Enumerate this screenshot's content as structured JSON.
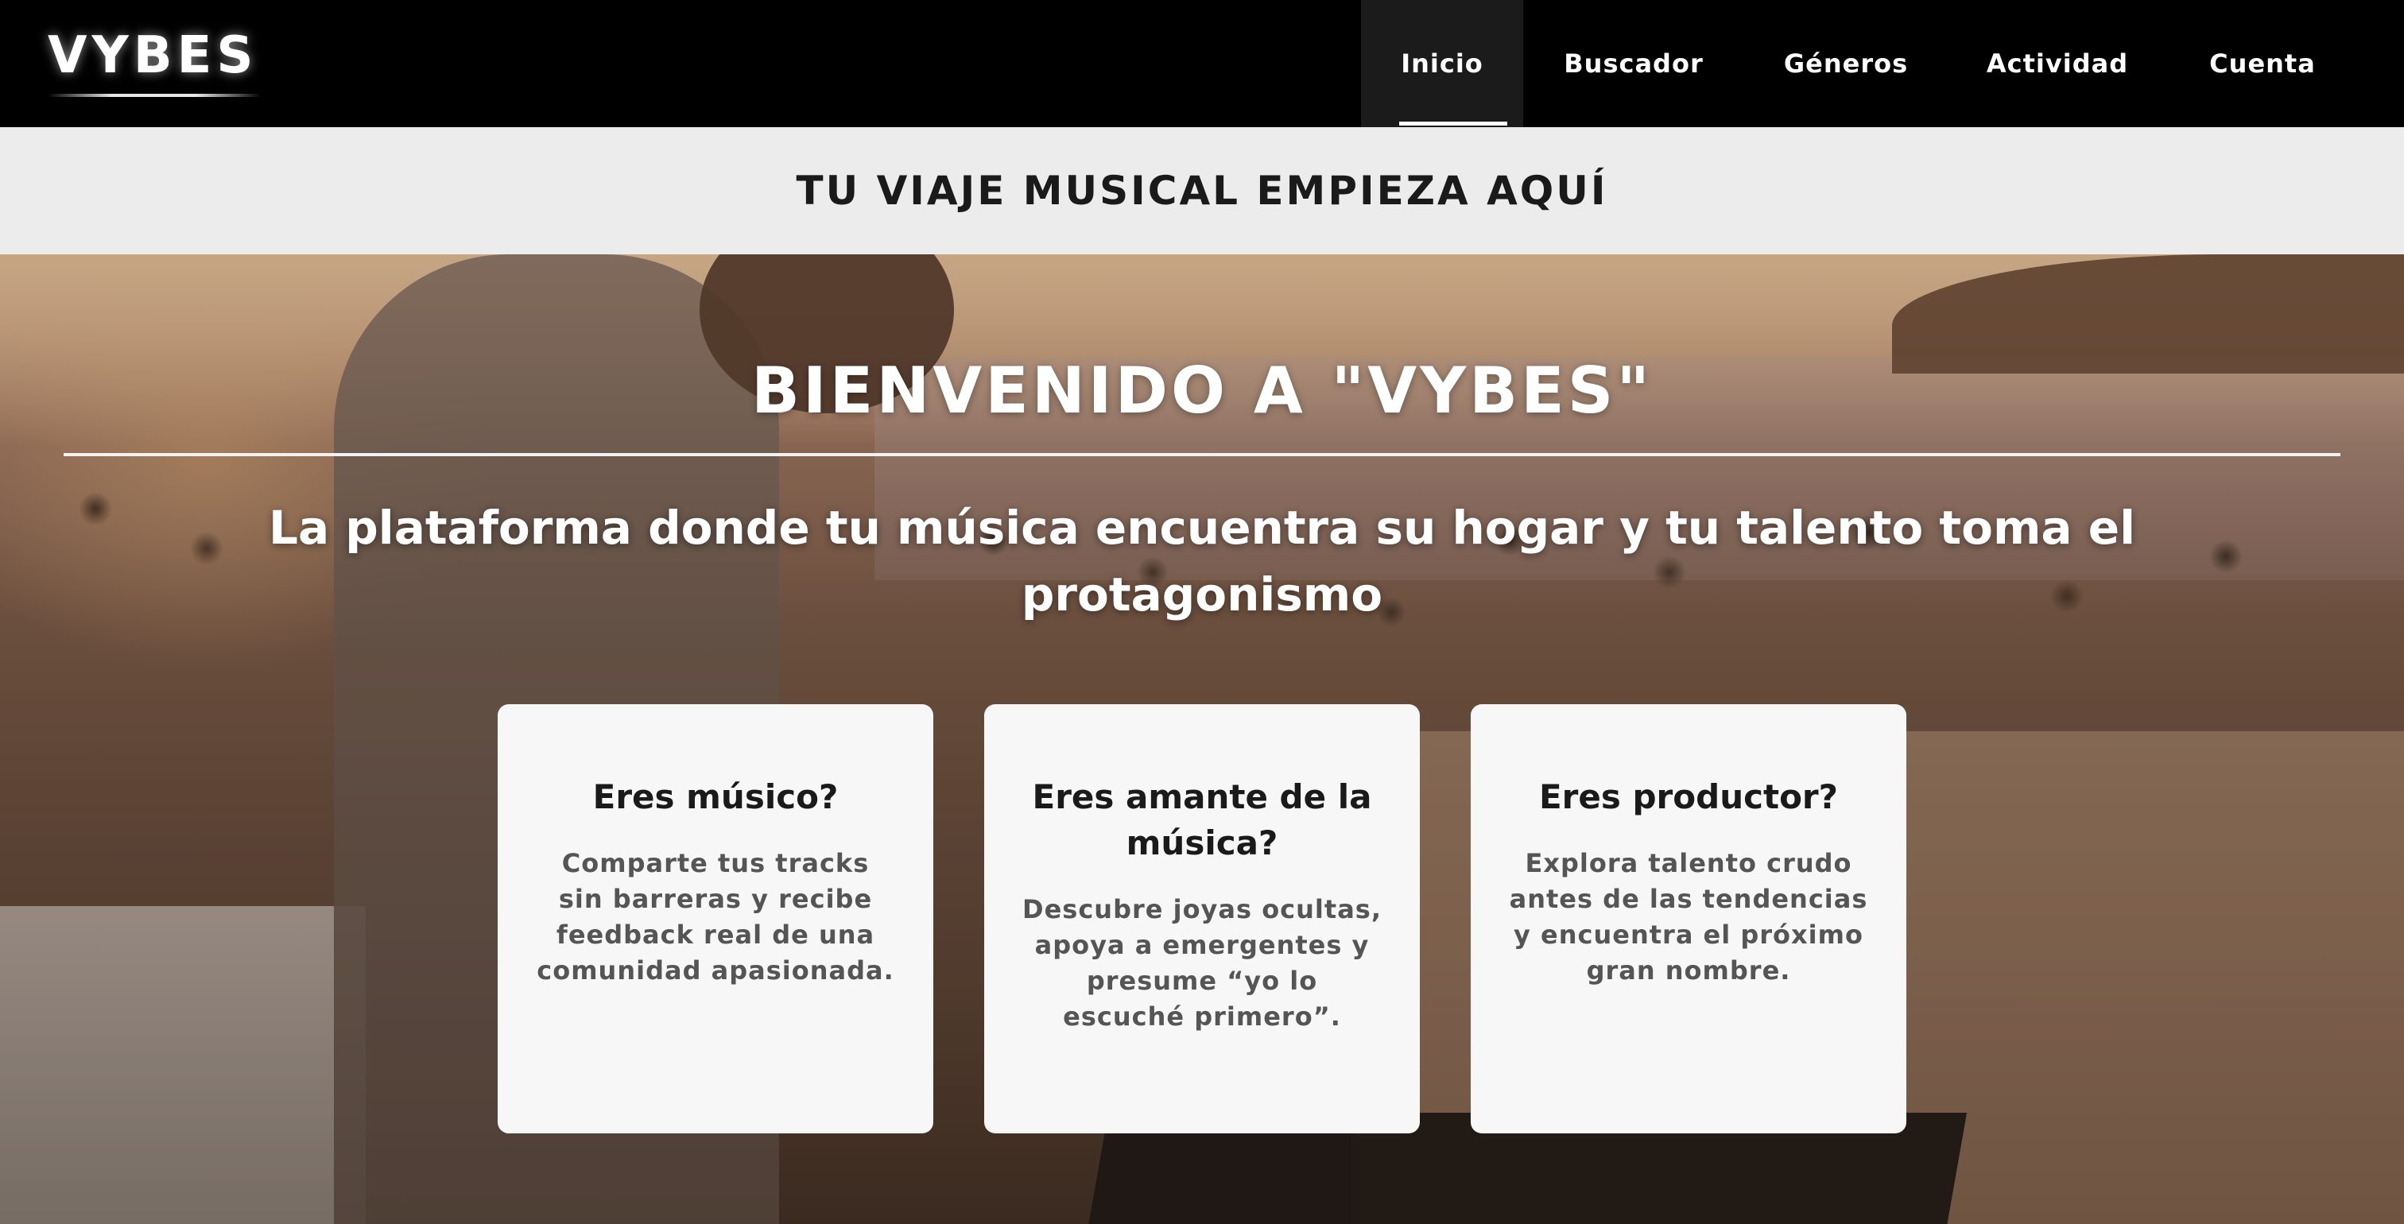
{
  "brand": {
    "logo_text": "VYBES"
  },
  "nav": {
    "items": [
      {
        "label": "Inicio",
        "active": true
      },
      {
        "label": "Buscador"
      },
      {
        "label": "Géneros"
      },
      {
        "label": "Actividad"
      },
      {
        "label": "Cuenta"
      }
    ]
  },
  "banner": {
    "text": "TU VIAJE MUSICAL EMPIEZA AQUÍ"
  },
  "hero": {
    "title": "BIENVENIDO A \"VYBES\"",
    "subtitle": "La plataforma donde tu música encuentra su hogar y tu talento toma el protagonismo"
  },
  "cards": [
    {
      "title": "Eres músico?",
      "text": "Comparte tus tracks sin barreras y recibe feedback real de una comunidad apasionada."
    },
    {
      "title": "Eres amante de la música?",
      "text": "Descubre joyas ocultas, apoya a emergentes y presume “yo lo escuché primero”."
    },
    {
      "title": "Eres productor?",
      "text": "Explora talento crudo antes de las tendencias y encuentra el próximo gran nombre."
    }
  ],
  "colors": {
    "navbar_bg": "#000000",
    "banner_bg": "#ececec",
    "card_bg": "#f7f7f7",
    "text_dark": "#1a1a1a"
  }
}
